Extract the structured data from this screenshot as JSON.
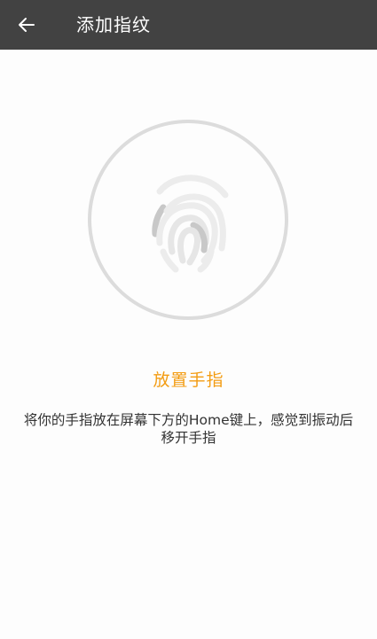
{
  "appbar": {
    "back_icon": "arrow-left-icon",
    "title": "添加指纹"
  },
  "fingerprint": {
    "icon": "fingerprint-icon"
  },
  "prompt": {
    "title": "放置手指",
    "description": "将你的手指放在屏幕下方的Home键上，感觉到振动后移开手指"
  },
  "colors": {
    "appbar_bg": "#424242",
    "accent": "#f39c12",
    "text": "#333333",
    "ring": "#dcdcdc"
  }
}
